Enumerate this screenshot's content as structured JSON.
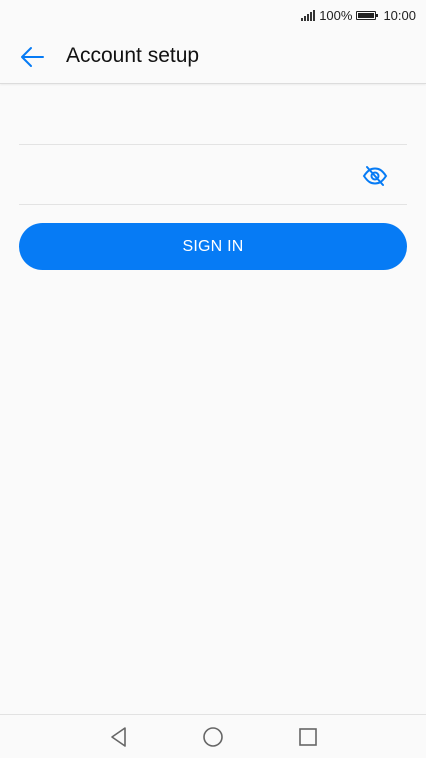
{
  "status_bar": {
    "battery": "100%",
    "time": "10:00"
  },
  "header": {
    "title": "Account setup",
    "back_icon": "arrow-left-icon"
  },
  "form": {
    "username": {
      "value": "",
      "placeholder": ""
    },
    "password": {
      "value": "",
      "placeholder": "",
      "toggle_icon": "eye-off-icon"
    },
    "sign_in_label": "SIGN IN"
  },
  "colors": {
    "accent": "#067bf5",
    "background": "#fafafa"
  },
  "nav_bar": {
    "icons": [
      "back-triangle-icon",
      "home-circle-icon",
      "recents-square-icon"
    ]
  }
}
